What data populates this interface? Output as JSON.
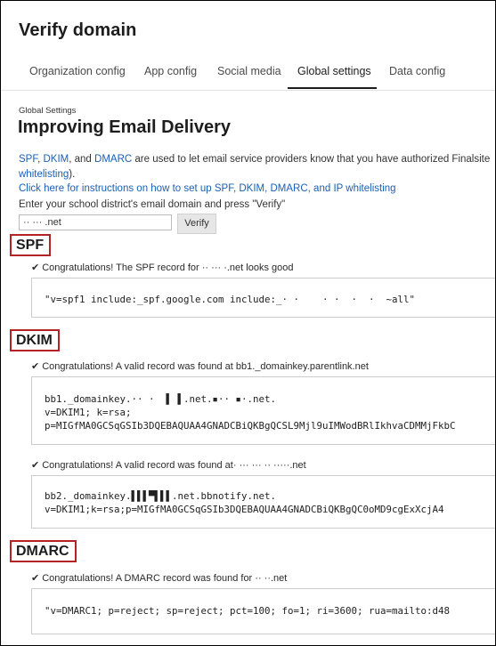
{
  "page": {
    "title": "Verify domain"
  },
  "tabs": [
    {
      "label": "Organization config"
    },
    {
      "label": "App config"
    },
    {
      "label": "Social media"
    },
    {
      "label": "Global settings"
    },
    {
      "label": "Data config"
    }
  ],
  "section_label": "Global Settings",
  "heading": "Improving Email Delivery",
  "intro": {
    "spf": "SPF",
    "sep1": ", ",
    "dkim": "DKIM",
    "sep2": ", and ",
    "dmarc": "DMARC",
    "rest": " are used to let email service providers know that you have authorized Finalsite",
    "whitelisting": "whitelisting",
    "close": ")."
  },
  "instructions_link": "Click here for instructions on how to set up SPF, DKIM, DMARC, and IP whitelisting",
  "domain_prompt": "Enter your school district's email domain and press \"Verify\"",
  "domain_input_value": "·· ··· .net",
  "verify_label": "Verify",
  "spf": {
    "heading": "SPF",
    "message": "Congratulations! The SPF record for ·· ··· ·.net looks good",
    "record": "\"v=spf1 include:_spf.google.com include:_· ·    · ·  ·  ·  ~all\""
  },
  "dkim": {
    "heading": "DKIM",
    "message1": "Congratulations! A valid record was found at bb1._domainkey.parentlink.net",
    "record1": "bb1._domainkey.·· ·  ▌ ▌.net.▪·· ▪·.net.\nv=DKIM1; k=rsa;\np=MIGfMA0GCSqGSIb3DQEBAQUAA4GNADCBiQKBgQCSL9Mjl9uIMWodBRlIkhvaCDMMjFkbC",
    "message2": "Congratulations! A valid record was found at·  ··· ··· ·· ·····.net",
    "record2": "bb2._domainkey.▌▌▌▀▌▌▌.net.bbnotify.net.\nv=DKIM1;k=rsa;p=MIGfMA0GCSqGSIb3DQEBAQUAA4GNADCBiQKBgQC0oMD9cgExXcjA4"
  },
  "dmarc": {
    "heading": "DMARC",
    "message": "Congratulations! A DMARC record was found for ·· ··.net",
    "record": "\"v=DMARC1; p=reject; sp=reject; pct=100; fo=1; ri=3600; rua=mailto:d48"
  },
  "icons": {
    "check": "✔"
  }
}
